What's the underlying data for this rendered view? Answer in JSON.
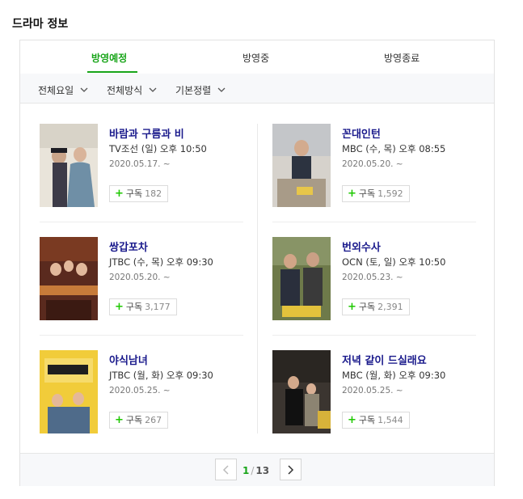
{
  "page": {
    "title": "드라마 정보"
  },
  "tabs": [
    {
      "label": "방영예정",
      "active": true
    },
    {
      "label": "방영중",
      "active": false
    },
    {
      "label": "방영종료",
      "active": false
    }
  ],
  "filters": [
    {
      "label": "전체요일"
    },
    {
      "label": "전체방식"
    },
    {
      "label": "기본정렬"
    }
  ],
  "dramas": [
    {
      "title": "바람과 구름과 비",
      "schedule": "TV조선 (일) 오후 10:50",
      "date": "2020.05.17. ~",
      "subscribe_label": "구독",
      "subscribers": "182"
    },
    {
      "title": "꼰대인턴",
      "schedule": "MBC (수, 목) 오후 08:55",
      "date": "2020.05.20. ~",
      "subscribe_label": "구독",
      "subscribers": "1,592"
    },
    {
      "title": "쌍갑포차",
      "schedule": "JTBC (수, 목) 오후 09:30",
      "date": "2020.05.20. ~",
      "subscribe_label": "구독",
      "subscribers": "3,177"
    },
    {
      "title": "번외수사",
      "schedule": "OCN (토, 일) 오후 10:50",
      "date": "2020.05.23. ~",
      "subscribe_label": "구독",
      "subscribers": "2,391"
    },
    {
      "title": "야식남녀",
      "schedule": "JTBC (월, 화) 오후 09:30",
      "date": "2020.05.25. ~",
      "subscribe_label": "구독",
      "subscribers": "267"
    },
    {
      "title": "저녁 같이 드실래요",
      "schedule": "MBC (월, 화) 오후 09:30",
      "date": "2020.05.25. ~",
      "subscribe_label": "구독",
      "subscribers": "1,544"
    }
  ],
  "pagination": {
    "current": "1",
    "separator": "/",
    "total": "13"
  },
  "colors": {
    "accent": "#19a51a",
    "title_link": "#1a1a8c",
    "plus_icon": "#1ec800"
  }
}
